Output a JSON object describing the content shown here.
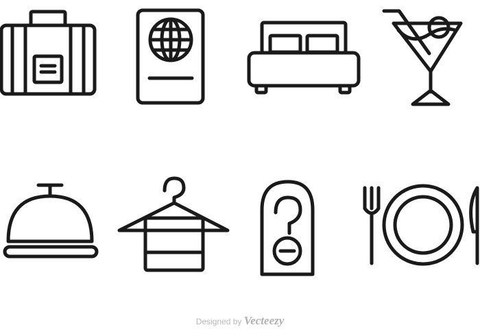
{
  "icons": [
    {
      "id": "luggage",
      "name": "luggage-icon"
    },
    {
      "id": "passport",
      "name": "passport-icon"
    },
    {
      "id": "bed",
      "name": "bed-icon"
    },
    {
      "id": "cocktail",
      "name": "cocktail-icon"
    },
    {
      "id": "bell",
      "name": "service-bell-icon"
    },
    {
      "id": "hanger",
      "name": "towel-hanger-icon"
    },
    {
      "id": "door-sign",
      "name": "do-not-disturb-sign-icon"
    },
    {
      "id": "dining",
      "name": "dining-plate-cutlery-icon"
    }
  ],
  "colors": {
    "icon_stroke": "#1a1a1a",
    "background": "#ffffff",
    "watermark": "#b8b8b8"
  },
  "watermark": {
    "prefix": "Designed by",
    "brand": "Vecteezy"
  }
}
